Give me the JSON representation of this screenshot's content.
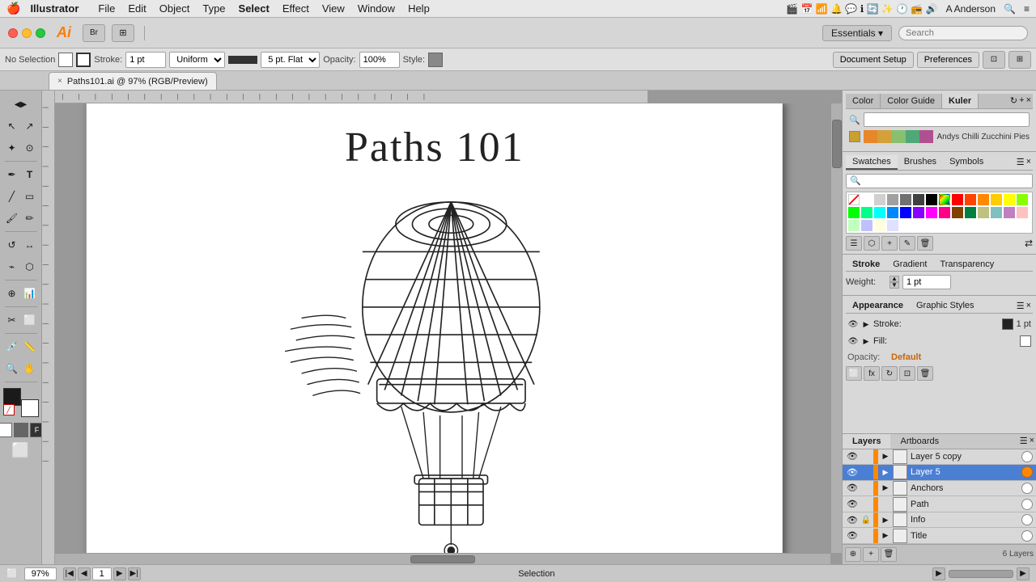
{
  "menubar": {
    "apple": "🍎",
    "app_name": "Illustrator",
    "menus": [
      "File",
      "Edit",
      "Object",
      "Type",
      "Select",
      "Effect",
      "View",
      "Window",
      "Help"
    ],
    "right": {
      "user": "A Anderson",
      "search_icon": "🔍"
    }
  },
  "titlebar": {
    "ai_logo": "Ai",
    "buttons": [
      "⊞",
      "⋯"
    ],
    "search_placeholder": "Search"
  },
  "optionsbar": {
    "selection_label": "No Selection",
    "stroke_label": "Stroke:",
    "stroke_value": "1 pt",
    "stroke_style": "Uniform",
    "stroke_cap": "5 pt. Flat",
    "opacity_label": "Opacity:",
    "opacity_value": "100%",
    "style_label": "Style:",
    "doc_setup": "Document Setup",
    "preferences": "Preferences"
  },
  "tabbar": {
    "doc_name": "Paths101.ai @ 97% (RGB/Preview)",
    "close": "×"
  },
  "toolbar": {
    "tools": [
      {
        "name": "selection-tool",
        "icon": "↖",
        "label": "Selection Tool"
      },
      {
        "name": "direct-selection-tool",
        "icon": "↗",
        "label": "Direct Selection"
      },
      {
        "name": "magic-wand-tool",
        "icon": "✦",
        "label": "Magic Wand"
      },
      {
        "name": "lasso-tool",
        "icon": "⊙",
        "label": "Lasso"
      },
      {
        "name": "pen-tool",
        "icon": "✒",
        "label": "Pen"
      },
      {
        "name": "type-tool",
        "icon": "T",
        "label": "Type"
      },
      {
        "name": "line-tool",
        "icon": "╱",
        "label": "Line"
      },
      {
        "name": "rectangle-tool",
        "icon": "▭",
        "label": "Rectangle"
      },
      {
        "name": "paintbrush-tool",
        "icon": "🖌",
        "label": "Paintbrush"
      },
      {
        "name": "pencil-tool",
        "icon": "✏",
        "label": "Pencil"
      },
      {
        "name": "rotate-tool",
        "icon": "↺",
        "label": "Rotate"
      },
      {
        "name": "blend-tool",
        "icon": "⬟",
        "label": "Blend"
      },
      {
        "name": "chart-tool",
        "icon": "📊",
        "label": "Chart"
      },
      {
        "name": "eyedropper-tool",
        "icon": "💉",
        "label": "Eyedropper"
      },
      {
        "name": "zoom-tool",
        "icon": "🔍",
        "label": "Zoom"
      },
      {
        "name": "hand-tool",
        "icon": "✋",
        "label": "Hand"
      }
    ]
  },
  "canvas": {
    "title": "Paths 101",
    "zoom": "97%"
  },
  "right_panel": {
    "color_tabs": [
      "Color",
      "Color Guide",
      "Kuler"
    ],
    "active_color_tab": "Kuler",
    "kuler_search_placeholder": "🔍",
    "kuler_name": "Andys Chilli Zucchini Pies",
    "kuler_colors": [
      "#e8872a",
      "#d4a03a",
      "#88c070",
      "#50a878",
      "#b05090"
    ],
    "swatches_tabs": [
      "Swatches",
      "Brushes",
      "Symbols"
    ],
    "active_swatches_tab": "Swatches",
    "swatches_search_placeholder": "🔍",
    "stroke_tabs": [
      "Stroke",
      "Gradient",
      "Transparency"
    ],
    "active_stroke_tab": "Stroke",
    "stroke_weight_label": "Weight:",
    "stroke_weight_value": "1 pt",
    "appearance_tabs": [
      "Appearance",
      "Graphic Styles"
    ],
    "active_appearance_tab": "Appearance",
    "appearance_rows": [
      {
        "label": "Stroke:",
        "swatch_color": "#222222",
        "value": "1 pt"
      },
      {
        "label": "Fill:",
        "swatch_color": "#ffffff",
        "value": ""
      }
    ],
    "opacity_label": "Opacity:",
    "opacity_value": "Default",
    "layers_tabs": [
      "Layers",
      "Artboards"
    ],
    "active_layers_tab": "Layers",
    "layers": [
      {
        "name": "Layer 5 copy",
        "color": "#ff8800",
        "visible": true,
        "locked": false,
        "has_sublayers": true,
        "target": false,
        "indent": 0
      },
      {
        "name": "Layer 5",
        "color": "#ff8800",
        "visible": true,
        "locked": false,
        "has_sublayers": true,
        "target": true,
        "indent": 0
      },
      {
        "name": "Anchors",
        "color": "#ff8800",
        "visible": true,
        "locked": false,
        "has_sublayers": true,
        "target": false,
        "indent": 0
      },
      {
        "name": "Path",
        "color": "#ff8800",
        "visible": true,
        "locked": false,
        "has_sublayers": false,
        "target": false,
        "indent": 0
      },
      {
        "name": "Info",
        "color": "#ff8800",
        "visible": true,
        "locked": true,
        "has_sublayers": true,
        "target": false,
        "indent": 0
      },
      {
        "name": "Title",
        "color": "#ff8800",
        "visible": true,
        "locked": false,
        "has_sublayers": true,
        "target": false,
        "indent": 0
      }
    ],
    "layers_footer": "6 Layers"
  },
  "statusbar": {
    "artboard_icon": "⬜",
    "zoom_value": "97%",
    "nav_first": "◀◀",
    "nav_prev": "◀",
    "page_value": "1",
    "nav_next": "▶",
    "nav_last": "▶▶",
    "tool_name": "Selection",
    "play_btn": "▶",
    "scroll_indicator": ""
  }
}
